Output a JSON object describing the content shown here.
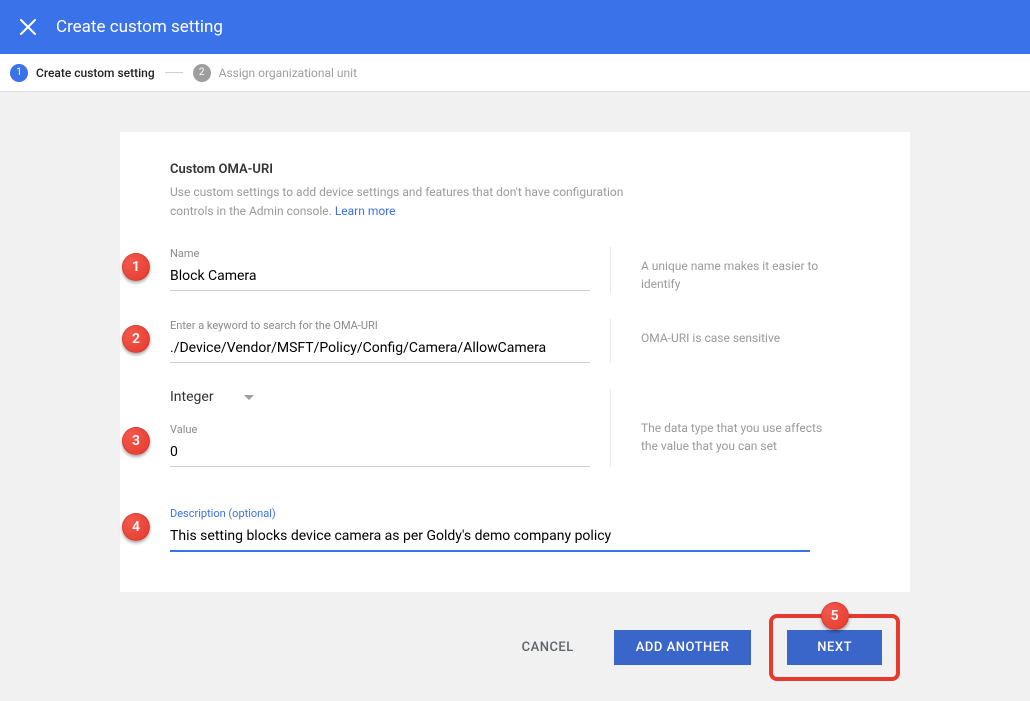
{
  "header": {
    "title": "Create custom setting"
  },
  "stepper": {
    "step1": {
      "num": "1",
      "label": "Create custom setting"
    },
    "step2": {
      "num": "2",
      "label": "Assign organizational unit"
    }
  },
  "card": {
    "title": "Custom OMA-URI",
    "subtitle_pre": "Use custom settings to add device settings and features that don't have configuration controls in the Admin console. ",
    "learn_more": "Learn more"
  },
  "fields": {
    "name": {
      "label": "Name",
      "value": "Block Camera",
      "hint": "A unique name makes it easier to identify"
    },
    "omauri": {
      "label": "Enter a keyword to search for the OMA-URI",
      "value": "./Device/Vendor/MSFT/Policy/Config/Camera/AllowCamera",
      "hint": "OMA-URI is case sensitive"
    },
    "datatype": {
      "selected": "Integer",
      "value_label": "Value",
      "value": "0",
      "hint": "The data type that you use affects the value that you can set"
    },
    "description": {
      "label": "Description (optional)",
      "value": "This setting blocks device camera as per Goldy's demo company policy"
    }
  },
  "buttons": {
    "cancel": "CANCEL",
    "add_another": "ADD ANOTHER",
    "next": "NEXT"
  },
  "annotations": {
    "a1": "1",
    "a2": "2",
    "a3": "3",
    "a4": "4",
    "a5": "5"
  }
}
